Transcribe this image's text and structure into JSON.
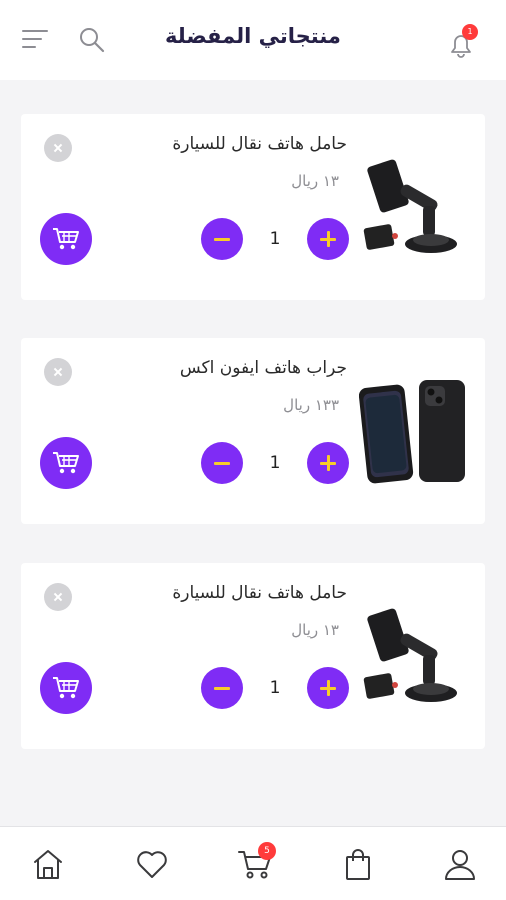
{
  "header": {
    "title": "منتجاتي المفضلة",
    "menu_icon": "hamburger-menu-icon",
    "search_icon": "search-icon",
    "bell_icon": "bell-icon",
    "notification_count": "1"
  },
  "items": [
    {
      "name": "حامل هاتف نقال للسيارة",
      "price": "١٣ ريال",
      "quantity": "1",
      "image_icon": "car-phone-holder-image"
    },
    {
      "name": "جراب هاتف ايفون اكس",
      "price": "١٣٣ ريال",
      "quantity": "1",
      "image_icon": "iphone-case-image"
    },
    {
      "name": "حامل هاتف نقال للسيارة",
      "price": "١٣ ريال",
      "quantity": "1",
      "image_icon": "car-phone-holder-image"
    }
  ],
  "bottom_nav": {
    "items": [
      "home-icon",
      "heart-icon",
      "cart-icon",
      "bag-icon",
      "user-icon"
    ],
    "cart_count": "5"
  },
  "colors": {
    "accent": "#7f2cf5",
    "stepper_symbol": "#f8cc2a",
    "badge": "#ff3b3b",
    "title": "#262147",
    "background": "#f4f4f6"
  }
}
